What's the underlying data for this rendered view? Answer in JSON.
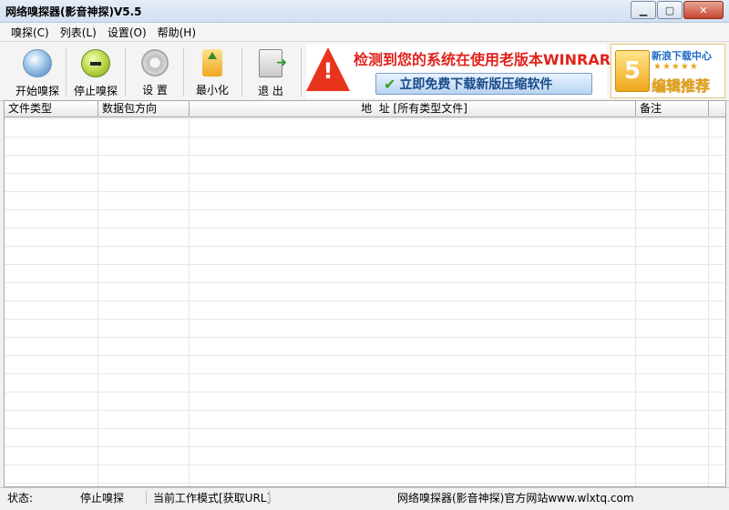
{
  "window": {
    "title": "网络嗅探器(影音神探)V5.5"
  },
  "menu": [
    "嗅探(C)",
    "列表(L)",
    "设置(O)",
    "帮助(H)"
  ],
  "toolbar": {
    "start": "开始嗅探",
    "stop": "停止嗅探",
    "settings": "设 置",
    "minimize": "最小化",
    "exit": "退 出"
  },
  "ads": {
    "banner_text": "检测到您的系统在使用老版本WINRAR!",
    "banner_button": "立即免费下载新版压缩软件",
    "badge_number": "5",
    "badge_top": "新浪下载中心",
    "badge_stars": "★★★★★",
    "badge_bottom": "编辑推荐"
  },
  "table": {
    "columns": [
      "文件类型",
      "数据包方向",
      "地  址 [所有类型文件]",
      "备注"
    ],
    "rows": []
  },
  "status": {
    "label": "状态:",
    "state": "停止嗅探",
    "mode": "当前工作模式[获取URL]",
    "site": "网络嗅探器(影音神探)官方网站www.wlxtq.com"
  }
}
